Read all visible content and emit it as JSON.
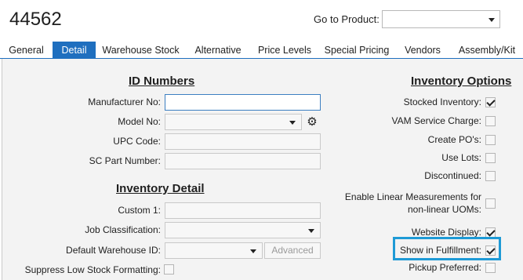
{
  "header": {
    "title": "44562",
    "goto_label": "Go to Product:",
    "goto_value": ""
  },
  "tabs": [
    {
      "label": "General",
      "active": false
    },
    {
      "label": "Detail",
      "active": true
    },
    {
      "label": "Warehouse Stock",
      "active": false
    },
    {
      "label": "Alternative",
      "active": false
    },
    {
      "label": "Price Levels",
      "active": false
    },
    {
      "label": "Special Pricing",
      "active": false
    },
    {
      "label": "Vendors",
      "active": false
    },
    {
      "label": "Assembly/Kit",
      "active": false
    }
  ],
  "id_numbers": {
    "heading": "ID Numbers",
    "manufacturer_no": {
      "label": "Manufacturer No:",
      "value": ""
    },
    "model_no": {
      "label": "Model No:",
      "value": ""
    },
    "upc_code": {
      "label": "UPC Code:",
      "value": ""
    },
    "sc_part_number": {
      "label": "SC Part Number:",
      "value": ""
    }
  },
  "inventory_detail": {
    "heading": "Inventory Detail",
    "custom1": {
      "label": "Custom 1:",
      "value": ""
    },
    "job_classification": {
      "label": "Job Classification:",
      "value": ""
    },
    "default_warehouse": {
      "label": "Default Warehouse ID:",
      "value": ""
    },
    "advanced_label": "Advanced",
    "suppress_low_stock": {
      "label": "Suppress Low Stock Formatting:",
      "checked": false
    }
  },
  "inventory_options": {
    "heading": "Inventory Options",
    "stocked_inventory": {
      "label": "Stocked Inventory:",
      "checked": true
    },
    "vam_service_charge": {
      "label": "VAM Service Charge:",
      "checked": false
    },
    "create_pos": {
      "label": "Create PO's:",
      "checked": false
    },
    "use_lots": {
      "label": "Use Lots:",
      "checked": false
    },
    "discontinued": {
      "label": "Discontinued:",
      "checked": false
    },
    "linear_measurements": {
      "label_line1": "Enable Linear Measurements for",
      "label_line2": "non-linear UOMs:",
      "checked": false
    },
    "website_display": {
      "label": "Website Display:",
      "checked": true
    },
    "show_in_fulfillment": {
      "label": "Show in Fulfillment:",
      "checked": true
    },
    "pickup_preferred": {
      "label": "Pickup Preferred:",
      "checked": false
    }
  },
  "colors": {
    "accent": "#1f6fbf",
    "highlight": "#1e9ad6",
    "panel_bg": "#f3f3f3"
  },
  "icons": [
    "gear-icon",
    "chevron-down-icon",
    "checkmark-icon"
  ]
}
